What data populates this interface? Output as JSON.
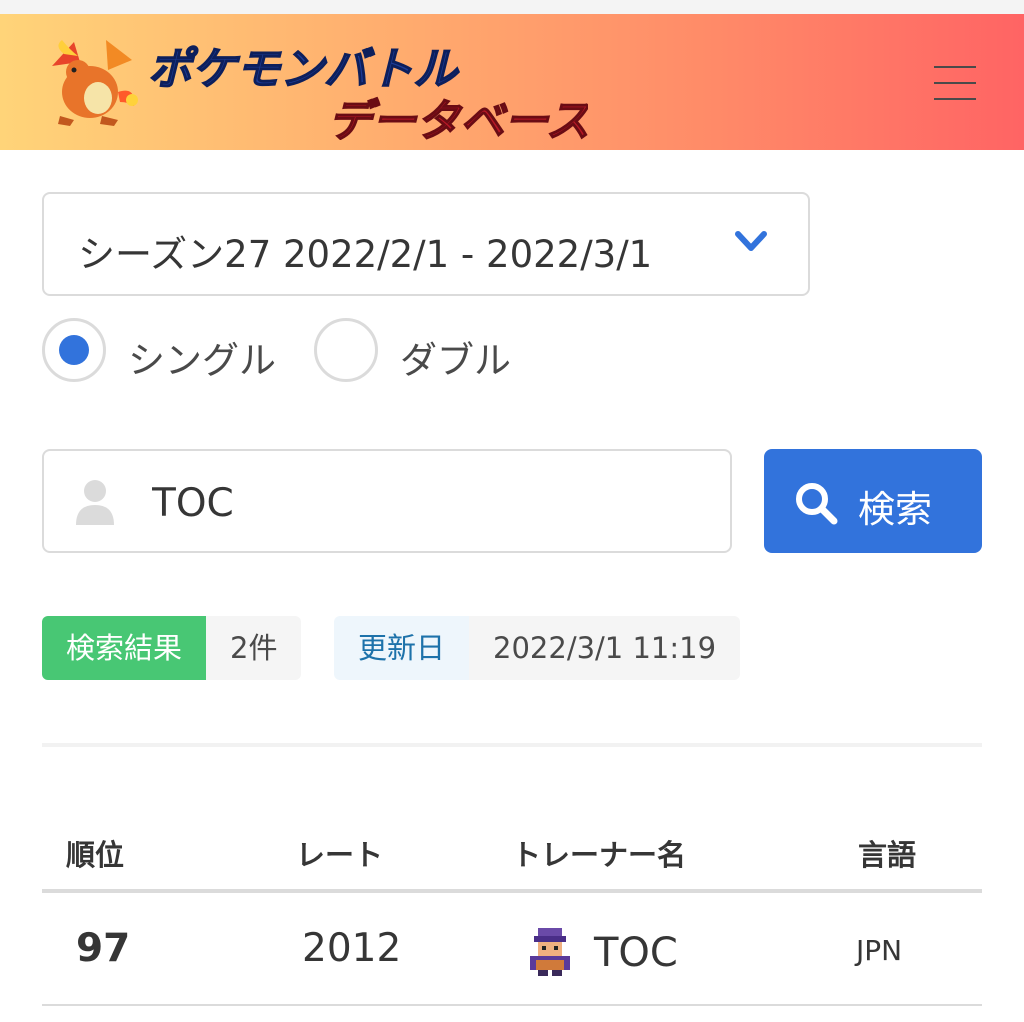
{
  "header": {
    "logo_title": "ポケモンバトルデータベース",
    "logo_line1": "ポケモンバトル",
    "logo_line2": "データベース"
  },
  "season_select": {
    "selected": "シーズン27  2022/2/1 - 2022/3/1"
  },
  "battle_type": {
    "options": [
      {
        "label": "シングル",
        "selected": true
      },
      {
        "label": "ダブル",
        "selected": false
      }
    ]
  },
  "search": {
    "value": "TOC",
    "button_label": "検索"
  },
  "result_tags": {
    "results_label": "検索結果",
    "results_count": "2件",
    "updated_label": "更新日",
    "updated_value": "2022/3/1 11:19"
  },
  "table": {
    "headers": [
      "順位",
      "レート",
      "トレーナー名",
      "言語"
    ],
    "rows": [
      {
        "rank": "97",
        "rate": "2012",
        "trainer": "TOC",
        "language": "JPN"
      }
    ]
  },
  "colors": {
    "primary": "#3273dc",
    "success": "#48c774",
    "header_gradient_start": "#ffd479",
    "header_gradient_end": "#ff6464"
  }
}
